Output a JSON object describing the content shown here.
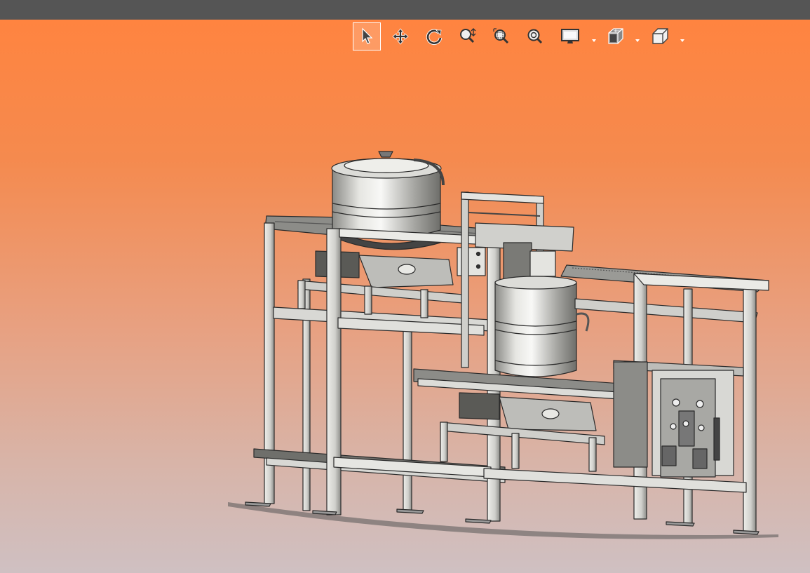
{
  "window": {
    "titlebar_color": "#555555"
  },
  "viewport": {
    "gradient_top": "#ff8440",
    "gradient_bottom": "#cfc0c2"
  },
  "toolbar": {
    "tools": [
      {
        "id": "select",
        "icon": "arrow-cursor-icon",
        "active": true
      },
      {
        "id": "pan",
        "icon": "move-arrows-icon"
      },
      {
        "id": "rotate",
        "icon": "rotate-icon"
      },
      {
        "id": "zoom-in-out",
        "icon": "zoom-in-out-icon"
      },
      {
        "id": "zoom-to-area",
        "icon": "zoom-area-icon"
      },
      {
        "id": "zoom-to-fit",
        "icon": "zoom-fit-icon"
      },
      {
        "id": "display-style",
        "icon": "monitor-icon",
        "dropdown": true
      },
      {
        "id": "view-orientation",
        "icon": "view-cube-icon",
        "dropdown": true
      },
      {
        "id": "section-view",
        "icon": "box-3d-icon",
        "dropdown": true
      }
    ]
  },
  "model": {
    "description_icon": "machine-assembly-model",
    "metal_color": "#c8c8c4",
    "shadow_color": "#555555"
  }
}
